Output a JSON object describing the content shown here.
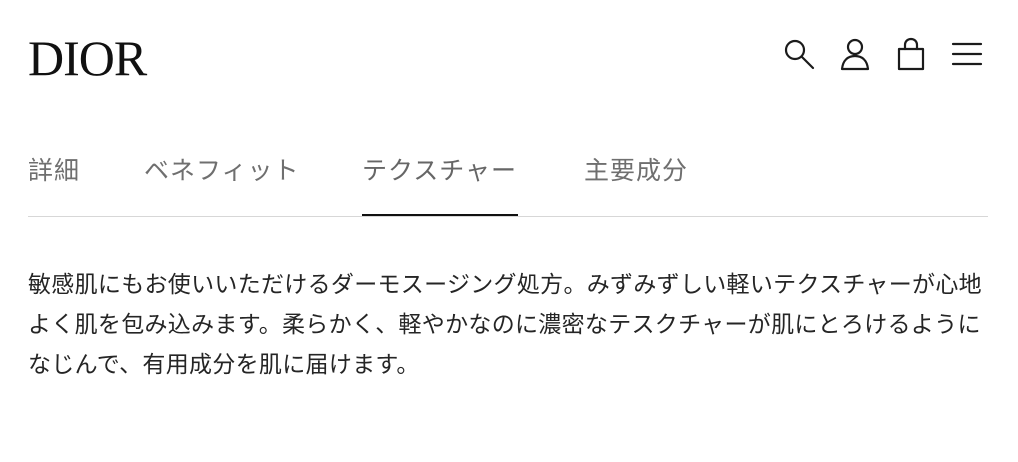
{
  "header": {
    "logo": "DIOR",
    "icons": {
      "search": "search-icon",
      "account": "user-icon",
      "cart": "bag-icon",
      "menu": "menu-icon"
    }
  },
  "tabs": [
    {
      "label": "詳細",
      "active": false
    },
    {
      "label": "ベネフィット",
      "active": false
    },
    {
      "label": "テクスチャー",
      "active": true
    },
    {
      "label": "主要成分",
      "active": false
    }
  ],
  "content": {
    "description": "敏感肌にもお使いいただけるダーモスージング処方。みずみずしい軽いテクスチャーが心地よく肌を包み込みます。柔らかく、軽やかなのに濃密なテスクチャーが肌にとろけるようになじんで、有用成分を肌に届けます。"
  },
  "colors": {
    "text": "#252525",
    "tab_inactive": "#6f6f6f",
    "active_underline": "#111111",
    "divider": "#d7d7d7"
  }
}
